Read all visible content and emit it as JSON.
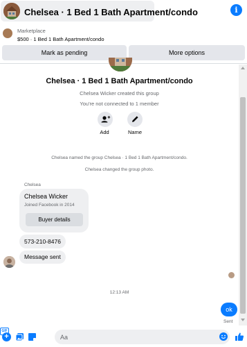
{
  "header": {
    "title": "Chelsea · 1 Bed 1 Bath Apartment/condo",
    "info_icon": "info-icon"
  },
  "listing": {
    "label": "Marketplace",
    "detail": "$500 · 1 Bed 1 Bath Apartment/condo"
  },
  "actions_bar": {
    "mark_pending": "Mark as pending",
    "more_options": "More options"
  },
  "group": {
    "title": "Chelsea · 1 Bed 1 Bath Apartment/condo",
    "creator_text": "Chelsea Wicker created this group",
    "members_text": "You're not connected to 1 member",
    "add_label": "Add",
    "name_label": "Name"
  },
  "system_messages": [
    "Chelsea named the group Chelsea · 1 Bed 1 Bath Apartment/condo.",
    "Chelsea changed the group photo."
  ],
  "conversation": {
    "sender_name": "Chelsea",
    "contact_card": {
      "name": "Chelsea Wicker",
      "subtitle": "Joined Facebook in 2014",
      "button": "Buyer details"
    },
    "messages": [
      "573-210-8476",
      "Message sent"
    ],
    "timestamp": "12:13 AM",
    "outgoing": {
      "text": "ok",
      "status": "Sent"
    }
  },
  "composer": {
    "placeholder": "Aa",
    "gif_label": "GIF"
  },
  "colors": {
    "accent": "#0a7cff",
    "bubble_gray": "#eeeff1",
    "button_gray": "#e4e6eb",
    "secondary_text": "#65676b"
  }
}
